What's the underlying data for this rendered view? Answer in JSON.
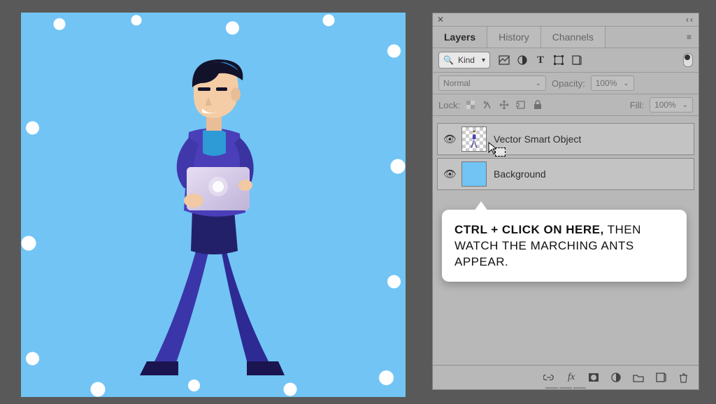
{
  "tabs": {
    "layers": "Layers",
    "history": "History",
    "channels": "Channels"
  },
  "filter": {
    "kind": "Kind"
  },
  "blend": {
    "mode": "Normal",
    "opacity_label": "Opacity:",
    "opacity_value": "100%"
  },
  "lock": {
    "label": "Lock:",
    "fill_label": "Fill:",
    "fill_value": "100%"
  },
  "layers": [
    {
      "name": "Vector Smart Object"
    },
    {
      "name": "Background"
    }
  ],
  "tooltip": {
    "bold": "CTRL + CLICK ON HERE,",
    "rest": " THEN WATCH THE MARCHING ANTS APPEAR."
  }
}
